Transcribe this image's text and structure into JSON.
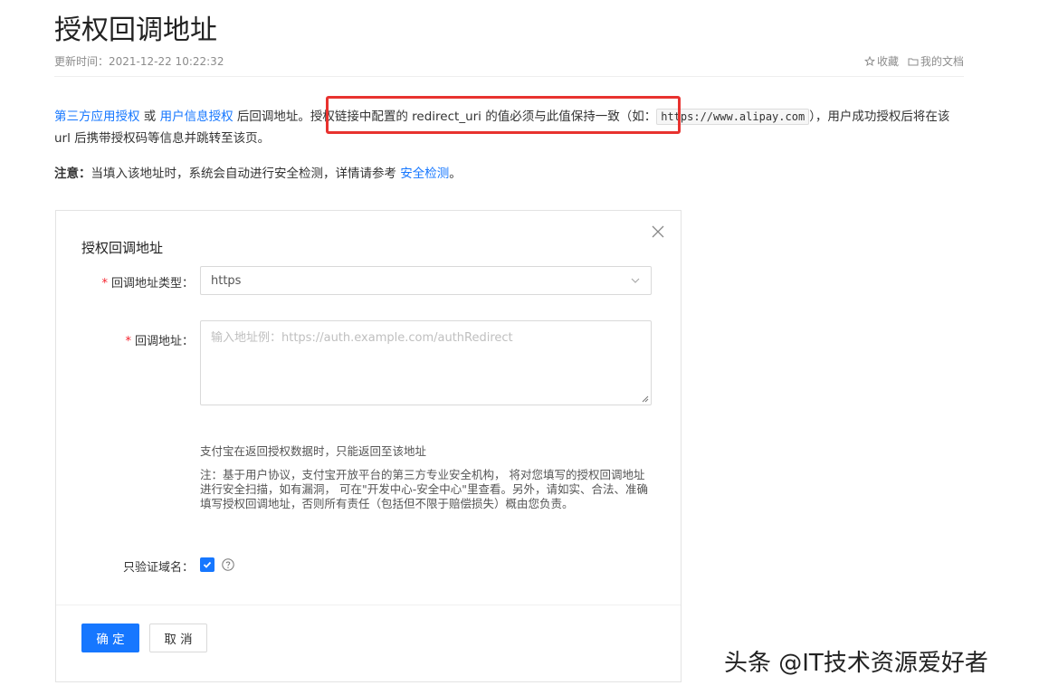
{
  "page": {
    "title": "授权回调地址",
    "updated": "更新时间：2021-12-22 10:22:32",
    "favorite_label": "收藏",
    "my_docs_label": "我的文档"
  },
  "intro": {
    "link1": "第三方应用授权",
    "or": " 或 ",
    "link2": "用户信息授权",
    "text1": " 后回调地址。授权链接中配置的 redirect_uri 的值必须与此值保持一致（如：",
    "code_example": "https://www.alipay.com",
    "text2": "），用户成功授权后将在该 url 后携带授权码等信息并跳转至该页。"
  },
  "note": {
    "prefix": "注意：",
    "text": "当填入该地址时，系统会自动进行安全检测，详情请参考 ",
    "link": "安全检测",
    "suffix": "。"
  },
  "modal": {
    "title": "授权回调地址",
    "type_label": "回调地址类型：",
    "type_value": "https",
    "url_label": "回调地址：",
    "url_placeholder": "输入地址例：https://auth.example.com/authRedirect",
    "help1": "支付宝在返回授权数据时，只能返回至该地址",
    "help2": "注：基于用户协议，支付宝开放平台的第三方专业安全机构， 将对您填写的授权回调地址进行安全扫描，如有漏洞， 可在\"开发中心-安全中心\"里查看。另外，请如实、合法、准确填写授权回调地址，否则所有责任（包括但不限于赔偿损失）概由您负责。",
    "domain_only_label": "只验证域名：",
    "domain_only_checked": true,
    "confirm_label": "确 定",
    "cancel_label": "取 消"
  },
  "watermark": "头条 @IT技术资源爱好者",
  "colors": {
    "accent": "#1677ff",
    "highlight_border": "#e8322f",
    "required": "#f5222d"
  }
}
